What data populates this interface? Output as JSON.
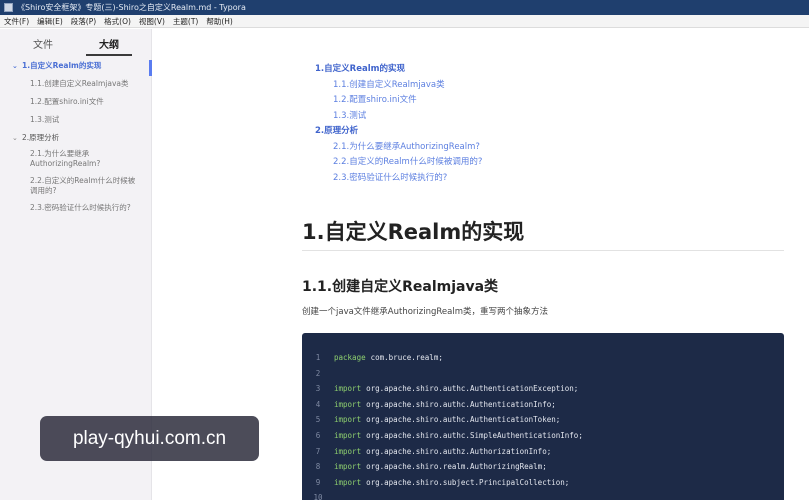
{
  "window": {
    "title": "《Shiro安全框架》专题(三)-Shiro之自定义Realm.md - Typora"
  },
  "menubar": {
    "items": [
      "文件(F)",
      "编辑(E)",
      "段落(P)",
      "格式(O)",
      "视图(V)",
      "主题(T)",
      "帮助(H)"
    ]
  },
  "sidebar": {
    "tabs": {
      "files": "文件",
      "outline": "大纲"
    },
    "outline": [
      {
        "label": "1.自定义Realm的实现",
        "level": 2,
        "active": true
      },
      {
        "label": "1.1.创建自定义Realmjava类",
        "level": 3
      },
      {
        "label": "1.2.配置shiro.ini文件",
        "level": 3
      },
      {
        "label": "1.3.测试",
        "level": 3
      },
      {
        "label": "2.原理分析",
        "level": 2
      },
      {
        "label": "2.1.为什么要继承AuthorizingRealm?",
        "level": 3
      },
      {
        "label": "2.2.自定义的Realm什么时候被调用的?",
        "level": 3
      },
      {
        "label": "2.3.密码验证什么时候执行的?",
        "level": 3
      }
    ]
  },
  "toc": [
    {
      "label": "1.自定义Realm的实现",
      "level": 2
    },
    {
      "label": "1.1.创建自定义Realmjava类",
      "level": 3
    },
    {
      "label": "1.2.配置shiro.ini文件",
      "level": 3
    },
    {
      "label": "1.3.测试",
      "level": 3
    },
    {
      "label": "2.原理分析",
      "level": 2
    },
    {
      "label": "2.1.为什么要继承AuthorizingRealm?",
      "level": 3
    },
    {
      "label": "2.2.自定义的Realm什么时候被调用的?",
      "level": 3
    },
    {
      "label": "2.3.密码验证什么时候执行的?",
      "level": 3
    }
  ],
  "doc": {
    "h1": "1.自定义Realm的实现",
    "h2": "1.1.创建自定义Realmjava类",
    "paragraph": "创建一个java文件继承AuthorizingRealm类，重写两个抽象方法"
  },
  "code": [
    {
      "n": "1",
      "kw": "package",
      "text": "com.bruce.realm;"
    },
    {
      "n": "2",
      "kw": "",
      "text": ""
    },
    {
      "n": "3",
      "kw": "import",
      "text": "org.apache.shiro.authc.AuthenticationException;"
    },
    {
      "n": "4",
      "kw": "import",
      "text": "org.apache.shiro.authc.AuthenticationInfo;"
    },
    {
      "n": "5",
      "kw": "import",
      "text": "org.apache.shiro.authc.AuthenticationToken;"
    },
    {
      "n": "6",
      "kw": "import",
      "text": "org.apache.shiro.authc.SimpleAuthenticationInfo;"
    },
    {
      "n": "7",
      "kw": "import",
      "text": "org.apache.shiro.authz.AuthorizationInfo;"
    },
    {
      "n": "8",
      "kw": "import",
      "text": "org.apache.shiro.realm.AuthorizingRealm;"
    },
    {
      "n": "9",
      "kw": "import",
      "text": "org.apache.shiro.subject.PrincipalCollection;"
    },
    {
      "n": "10",
      "kw": "",
      "text": ""
    }
  ],
  "watermark": "play-qyhui.com.cn",
  "colors": {
    "link": "#4a6fd4",
    "code_bg": "#1d2a47",
    "keyword": "#8fd16f"
  }
}
